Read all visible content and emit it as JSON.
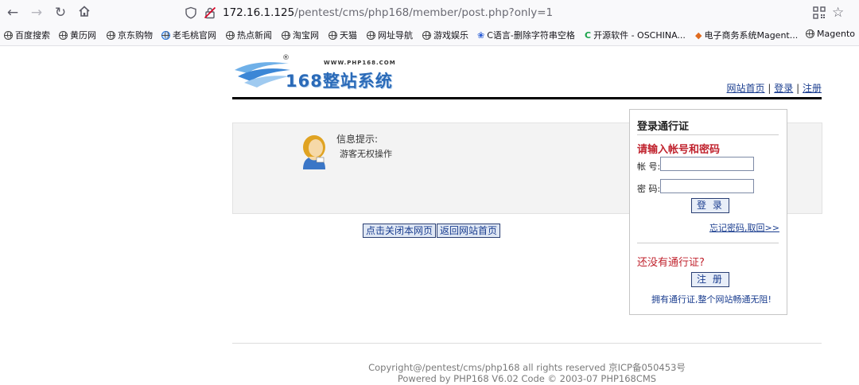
{
  "browser": {
    "url_host": "172.16.1.125",
    "url_path": "/pentest/cms/php168/member/post.php?only=1",
    "bookmarks": [
      "百度搜索",
      "黄历网",
      "京东购物",
      "老毛桃官网",
      "热点新闻",
      "淘宝网",
      "天猫",
      "网址导航",
      "游戏娱乐",
      "C语言-删除字符串空格",
      "开源软件 - OSCHINA...",
      "电子商务系统Magent...",
      "Magento"
    ]
  },
  "logo": {
    "reg": "®",
    "url": "WWW.PHP168.COM",
    "title": "168整站系统"
  },
  "top_links": {
    "home": "网站首页",
    "login": "登录",
    "register": "注册",
    "sep": "|"
  },
  "message": {
    "title": "信息提示:",
    "body": "游客无权操作"
  },
  "buttons": {
    "close": "点击关闭本网页",
    "back_home": "返回网站首页"
  },
  "login": {
    "heading": "登录通行证",
    "prompt": "请输入帐号和密码",
    "account_label": "帐 号:",
    "password_label": "密 码:",
    "account_value": "",
    "password_value": "",
    "login_button": "登 录",
    "forgot": "忘记密码,取回>>",
    "no_account": "还没有通行证?",
    "register_button": "注 册",
    "benefit": "拥有通行证,整个网站畅通无阻!"
  },
  "footer": {
    "copyright": "Copyright@/pentest/cms/php168 all rights reserved 京ICP备050453号",
    "powered": "Powered by PHP168 V6.02 Code © 2003-07 PHP168CMS"
  }
}
